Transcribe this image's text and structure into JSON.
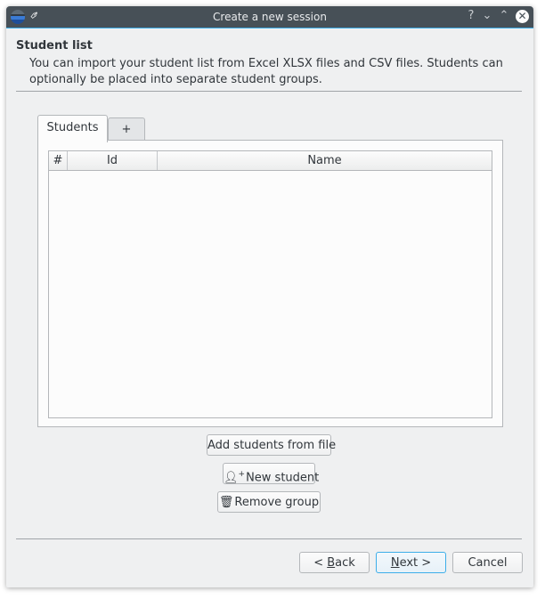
{
  "window": {
    "title": "Create a new session",
    "help_glyph": "?",
    "minimize_glyph": "⌄",
    "maximize_glyph": "⌃",
    "close_glyph": "✕",
    "pin_glyph": "📌"
  },
  "header": {
    "title": "Student list",
    "description": "You can import your student list from Excel XLSX files and CSV files. Students can optionally be placed into separate student groups."
  },
  "tabs": [
    {
      "label": "Students",
      "active": true
    },
    {
      "label": "+",
      "active": false
    }
  ],
  "table": {
    "columns": [
      "#",
      "Id",
      "Name"
    ],
    "rows": []
  },
  "actions": {
    "add_from_file": "Add students from file",
    "new_student": "New student",
    "new_student_icon": "⚲",
    "remove_group": "Remove group",
    "remove_group_icon": "🗑"
  },
  "footer": {
    "back_prefix": "< ",
    "back_mnemonic": "B",
    "back_rest": "ack",
    "next_mnemonic": "N",
    "next_rest": "ext >",
    "cancel": "Cancel"
  },
  "colors": {
    "accent": "#3daee9",
    "titlebar": "#475057",
    "background": "#eff0f1"
  }
}
